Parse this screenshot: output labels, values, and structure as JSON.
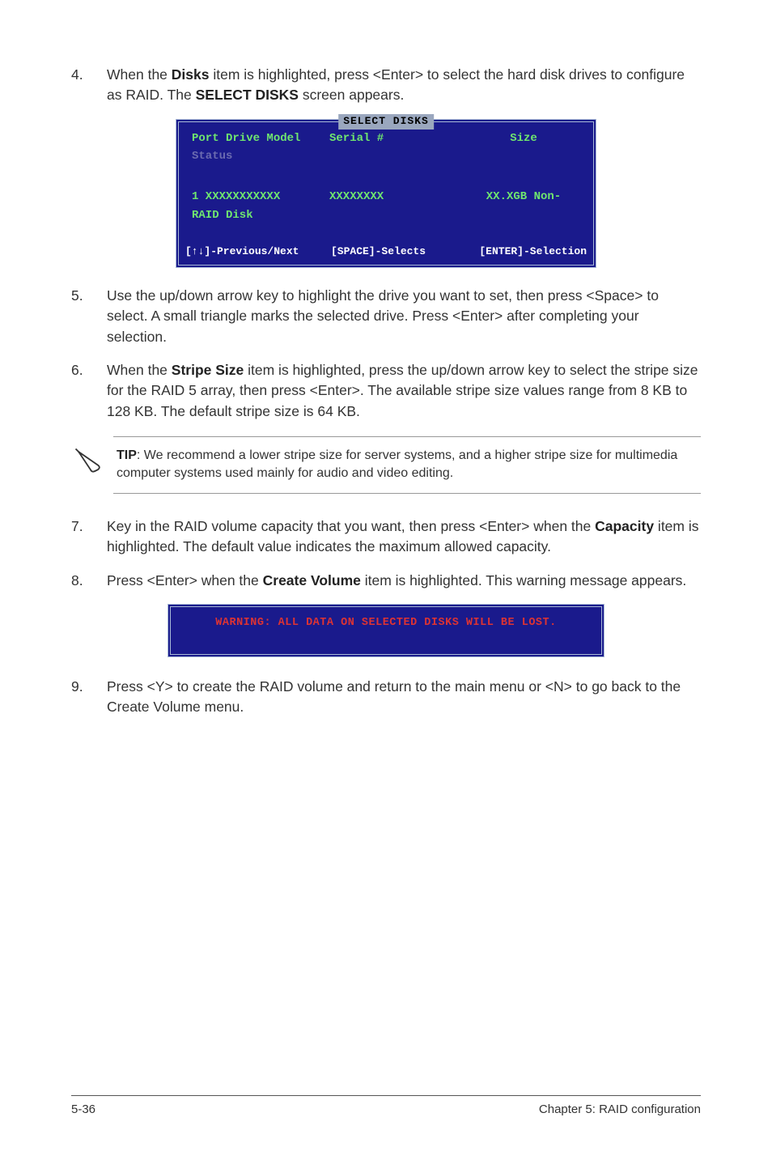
{
  "steps": {
    "s4": {
      "num": "4.",
      "t1": "When the ",
      "disks": "Disks",
      "t2": " item is highlighted, press <Enter> to select the hard disk drives to configure as RAID. The ",
      "sel": "SELECT DISKS",
      "t3": " screen appears."
    },
    "s5": {
      "num": "5.",
      "body": "Use the up/down arrow key to highlight the drive you want to set, then press <Space> to select. A small triangle marks the selected drive. Press <Enter> after completing your selection."
    },
    "s6": {
      "num": "6.",
      "t1": "When the ",
      "ss": "Stripe Size",
      "t2": " item is highlighted, press the up/down arrow key to select the stripe size for the RAID 5 array, then press <Enter>. The available stripe size values range from 8 KB to 128 KB. The default stripe size is 64 KB."
    },
    "s7": {
      "num": "7.",
      "t1": "Key in the RAID volume capacity that you want, then press <Enter> when the ",
      "cap": "Capacity",
      "t2": " item is highlighted. The default value indicates the maximum allowed capacity."
    },
    "s8": {
      "num": "8.",
      "t1": "Press <Enter> when the ",
      "cv": "Create Volume",
      "t2": " item is highlighted. This warning message appears."
    },
    "s9": {
      "num": "9.",
      "body": "Press <Y> to create the RAID volume and return to the main menu or <N> to go back to the Create Volume menu."
    }
  },
  "tip": {
    "label": "TIP",
    "body": ": We recommend a lower stripe size for server systems, and a higher stripe size for multimedia computer systems used mainly for audio and video editing."
  },
  "bios": {
    "title": "SELECT DISKS",
    "head": {
      "c1": "Port Drive Model",
      "c2": "Serial #",
      "c3": "Size"
    },
    "status": "Status",
    "row": {
      "c1": "1 XXXXXXXXXXX",
      "c2": "XXXXXXXX",
      "c3": "XX.XGB Non-"
    },
    "raid": "RAID Disk",
    "foot": {
      "f1": "[↑↓]-Previous/Next",
      "f2": "[SPACE]-Selects",
      "f3": "[ENTER]-Selection"
    }
  },
  "warn": "WARNING: ALL DATA ON SELECTED DISKS WILL BE LOST.",
  "footer": {
    "left": "5-36",
    "right": "Chapter 5: RAID configuration"
  }
}
